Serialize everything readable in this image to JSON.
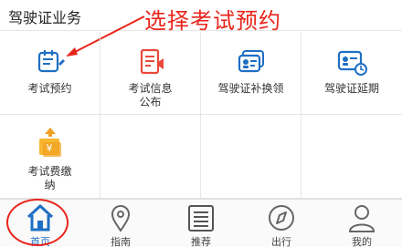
{
  "section": {
    "title": "驾驶证业务"
  },
  "annotation": {
    "text": "选择考试预约"
  },
  "colors": {
    "accent": "#1f6fc4",
    "annotation": "#e8251c",
    "orange": "#f0a020"
  },
  "services": [
    {
      "label": "考试预约",
      "icon": "exam-booking-icon"
    },
    {
      "label": "考试信息\n公布",
      "icon": "exam-info-icon"
    },
    {
      "label": "驾驶证补换领",
      "icon": "license-replace-icon"
    },
    {
      "label": "驾驶证延期",
      "icon": "license-extend-icon"
    },
    {
      "label": "考试费缴\n纳",
      "icon": "exam-fee-icon"
    }
  ],
  "tabs": [
    {
      "label": "首页",
      "icon": "home-icon",
      "active": true
    },
    {
      "label": "指南",
      "icon": "location-pin-icon"
    },
    {
      "label": "推荐",
      "icon": "list-icon"
    },
    {
      "label": "出行",
      "icon": "compass-icon"
    },
    {
      "label": "我的",
      "icon": "user-icon"
    }
  ]
}
